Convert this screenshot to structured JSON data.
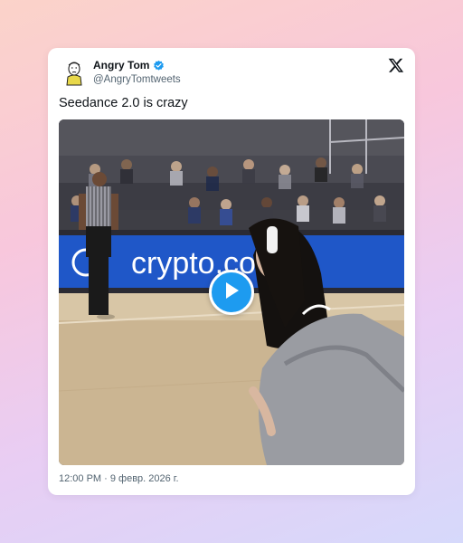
{
  "tweet": {
    "author_name": "Angry Tom",
    "handle": "@AngryTomtweets",
    "verified": true,
    "text": "Seedance 2.0 is crazy",
    "timestamp": "12:00 PM · 9 февр. 2026 г."
  },
  "media": {
    "type": "video",
    "arena_banner_text": "crypto.com"
  },
  "icons": {
    "platform": "x-logo-icon",
    "verified": "verified-badge-icon",
    "play": "play-icon"
  },
  "colors": {
    "accent": "#1d9bf0",
    "text_primary": "#0f1419",
    "text_secondary": "#536471",
    "banner": "#2f6fe0"
  }
}
